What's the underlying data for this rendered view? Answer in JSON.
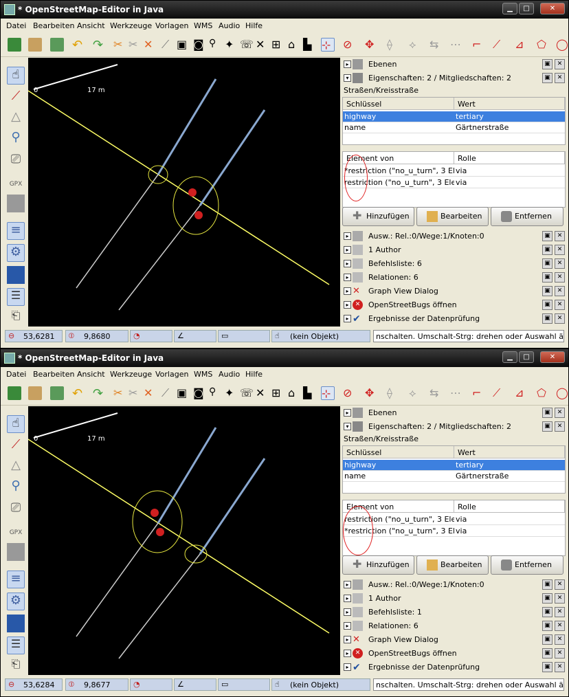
{
  "app": {
    "title": "* OpenStreetMap-Editor in Java",
    "menus": [
      "Datei",
      "Bearbeiten",
      "Ansicht",
      "Werkzeuge",
      "Vorlagen",
      "WMS",
      "Audio",
      "Hilfe"
    ]
  },
  "map": {
    "scale_left": "0",
    "scale_right": "17 m"
  },
  "panels": {
    "layers": "Ebenen",
    "preset": "Straßen/Kreisstraße",
    "tag_headers": [
      "Schlüssel",
      "Wert"
    ],
    "tags": [
      [
        "highway",
        "tertiary"
      ],
      [
        "name",
        "Gärtnerstraße"
      ]
    ],
    "member_headers": [
      "Element von",
      "Rolle"
    ],
    "buttons": [
      "Hinzufügen",
      "Bearbeiten",
      "Entfernen"
    ],
    "author": "1 Author",
    "graph": "Graph View Dialog",
    "bugs": "OpenStreetBugs öffnen",
    "validation": "Ergebnisse der Datenprüfung"
  },
  "status": {
    "angle": "",
    "object": "(kein Objekt)",
    "help": "nschalten. Umschalt-Strg: drehen oder Auswahl ändern."
  },
  "windows": [
    {
      "props_title": "Eigenschaften: 2 / Mitgliedschaften: 2",
      "members": [
        [
          "*restriction (\"no_u_turn\", 3 El...",
          "via"
        ],
        [
          "restriction (\"no_u_turn\", 3 Ele...",
          "via"
        ]
      ],
      "selection": "Ausw.: Rel.:0/Wege:1/Knoten:0",
      "commands": "Befehlsliste: 6",
      "relations": "Relationen: 6",
      "lat": "53,6281",
      "lon": "9,8680"
    },
    {
      "props_title": "Eigenschaften: 2 / Mitgliedschaften: 2",
      "members": [
        [
          "restriction (\"no_u_turn\", 3 Ele...",
          "via"
        ],
        [
          "*restriction (\"no_u_turn\", 3 El...",
          "via"
        ]
      ],
      "selection": "Ausw.: Rel.:0/Wege:1/Knoten:0",
      "commands": "Befehlsliste: 1",
      "relations": "Relationen: 6",
      "lat": "53,6284",
      "lon": "9,8677"
    }
  ],
  "colors": {
    "title_bar": "#1a1a1a",
    "selection": "#3d80df",
    "road": "#ffff66",
    "way": "#8aa8d0",
    "highlight": "#e8e840"
  },
  "icons": {
    "toolbar": [
      "download-icon",
      "open-icon",
      "upload-icon",
      "undo-icon",
      "redo-icon",
      "combine-icon",
      "split-icon",
      "merge-icon",
      "line-icon",
      "bus-icon",
      "car-icon",
      "bike-icon",
      "pedestrian-icon",
      "phone-icon",
      "tools-icon",
      "cart-icon",
      "building-icon",
      "factory-icon",
      "select-icon",
      "turn-restriction-icon",
      "move-icon"
    ]
  }
}
